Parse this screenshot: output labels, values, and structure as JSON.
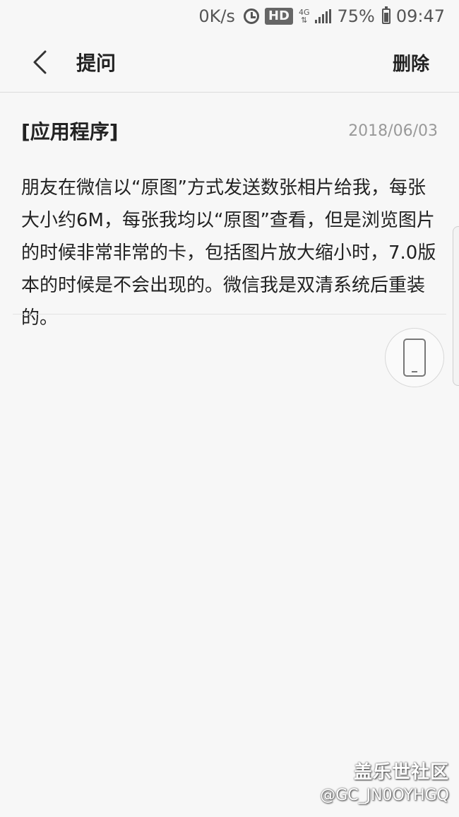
{
  "status_bar": {
    "speed": "0K/s",
    "hd": "HD",
    "network": "4G",
    "battery": "75%",
    "battery_level": 0.75,
    "time": "09:47"
  },
  "header": {
    "title": "提问",
    "delete_label": "删除",
    "back_icon": "chevron-left-icon"
  },
  "post": {
    "category": "[应用程序]",
    "date": "2018/06/03",
    "body": "朋友在微信以“原图”方式发送数张相片给我，每张大小约6M，每张我均以“原图”查看，但是浏览图片的时候非常非常的卡，包括图片放大缩小时，7.0版本的时候是不会出现的。微信我是双清系统后重装的。"
  },
  "floating": {
    "rotate_icon": "screen-rotate-icon"
  },
  "watermark": {
    "logo": "盖乐世社区",
    "user": "@GC_JN0OYHGQ"
  }
}
